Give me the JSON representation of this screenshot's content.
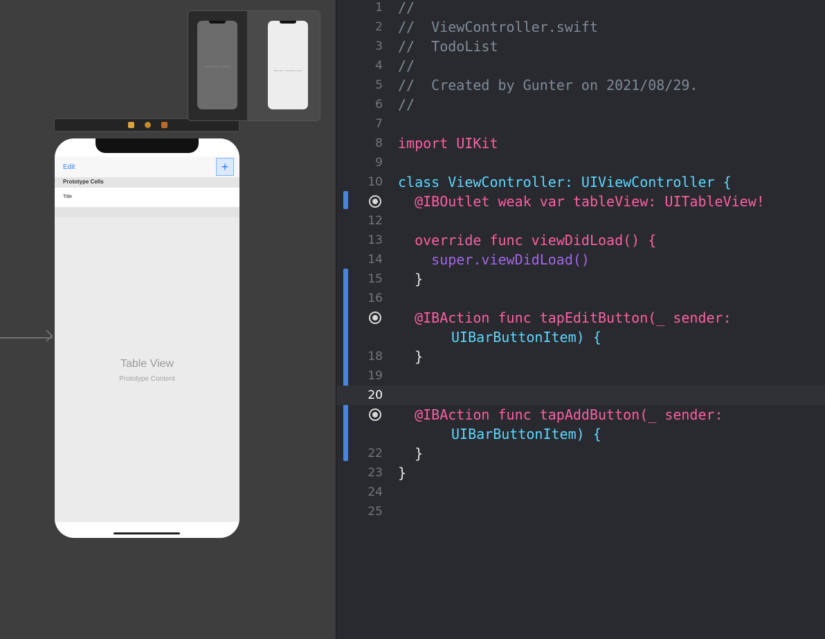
{
  "storyboard": {
    "nav": {
      "edit_label": "Edit",
      "add_label": "+"
    },
    "prototype_header": "Prototype Cells",
    "cell_title": "Title",
    "table_title": "Table View",
    "table_subtitle": "Prototype Content"
  },
  "thumbnails": {
    "left_text": "View controller · no content",
    "right_text": "Table View · Prototype Content"
  },
  "editor": {
    "current_line": "20",
    "lines": [
      {
        "n": "1",
        "t": "//"
      },
      {
        "n": "2",
        "t": "//  ViewController.swift"
      },
      {
        "n": "3",
        "t": "//  TodoList"
      },
      {
        "n": "4",
        "t": "//"
      },
      {
        "n": "5",
        "t": "//  Created by Gunter on 2021/08/29."
      },
      {
        "n": "6",
        "t": "//"
      },
      {
        "n": "7",
        "t": ""
      },
      {
        "n": "8",
        "t": "import UIKit"
      },
      {
        "n": "9",
        "t": ""
      },
      {
        "n": "10",
        "t": "class ViewController: UIViewController {"
      },
      {
        "n": "",
        "t": "  @IBOutlet weak var tableView: UITableView!"
      },
      {
        "n": "12",
        "t": ""
      },
      {
        "n": "13",
        "t": "  override func viewDidLoad() {"
      },
      {
        "n": "14",
        "t": "    super.viewDidLoad()"
      },
      {
        "n": "15",
        "t": "  }"
      },
      {
        "n": "16",
        "t": ""
      },
      {
        "n": "",
        "t": "  @IBAction func tapEditButton(_ sender:"
      },
      {
        "n": "",
        "t": "UIBarButtonItem) {"
      },
      {
        "n": "18",
        "t": "  }"
      },
      {
        "n": "19",
        "t": ""
      },
      {
        "n": "20",
        "t": ""
      },
      {
        "n": "",
        "t": "  @IBAction func tapAddButton(_ sender:"
      },
      {
        "n": "",
        "t": "UIBarButtonItem) {"
      },
      {
        "n": "22",
        "t": "  }"
      },
      {
        "n": "23",
        "t": "}"
      },
      {
        "n": "24",
        "t": ""
      },
      {
        "n": "25",
        "t": ""
      }
    ]
  },
  "colors": {
    "keyword": "#fc5fa3",
    "type": "#5dd8ff",
    "comment": "#7f8c98",
    "attribute": "#fd8f3f",
    "change_bar": "#4a84db",
    "ios_tint": "#2f7cf6"
  }
}
